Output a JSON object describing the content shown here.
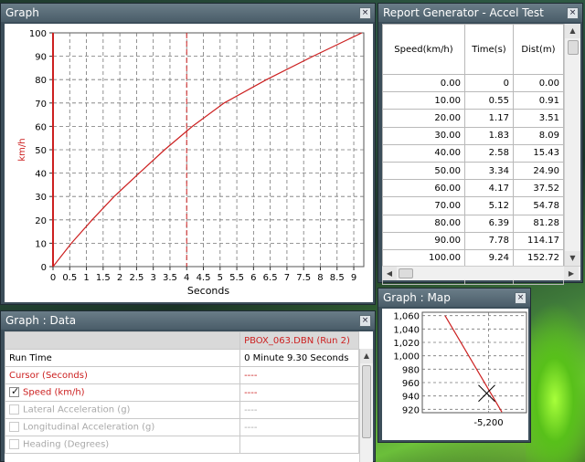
{
  "graph_window": {
    "title": "Graph",
    "close_glyph": "×",
    "chart_data": {
      "type": "line",
      "xlabel": "Seconds",
      "ylabel": "km/h",
      "xlim": [
        0,
        9.3
      ],
      "ylim": [
        0,
        100
      ],
      "x_ticks": [
        "0",
        "0.5",
        "1",
        "1.5",
        "2",
        "2.5",
        "3",
        "3.5",
        "4",
        "4.5",
        "5",
        "5.5",
        "6",
        "6.5",
        "7",
        "7.5",
        "8",
        "8.5",
        "9"
      ],
      "y_ticks": [
        "0",
        "10",
        "20",
        "30",
        "40",
        "50",
        "60",
        "70",
        "80",
        "90",
        "100"
      ],
      "grid": true,
      "cursor_x": 4.0,
      "series": [
        {
          "x": [
            0,
            0.55,
            1.17,
            1.83,
            2.58,
            3.34,
            4.17,
            5.12,
            6.39,
            7.78,
            9.24
          ],
          "y": [
            0,
            10,
            20,
            30,
            40,
            50,
            60,
            70,
            80,
            90,
            100
          ]
        }
      ],
      "colors": {
        "line": "#cc2020",
        "axis": "#cc2020",
        "grid": "#777777",
        "cursor": "#cc2020"
      }
    }
  },
  "report_window": {
    "title": "Report Generator - Accel Test",
    "close_glyph": "×",
    "columns": [
      "Speed(km/h)",
      "Time(s)",
      "Dist(m)"
    ],
    "rows": [
      [
        "0.00",
        "0",
        "0.00"
      ],
      [
        "10.00",
        "0.55",
        "0.91"
      ],
      [
        "20.00",
        "1.17",
        "3.51"
      ],
      [
        "30.00",
        "1.83",
        "8.09"
      ],
      [
        "40.00",
        "2.58",
        "15.43"
      ],
      [
        "50.00",
        "3.34",
        "24.90"
      ],
      [
        "60.00",
        "4.17",
        "37.52"
      ],
      [
        "70.00",
        "5.12",
        "54.78"
      ],
      [
        "80.00",
        "6.39",
        "81.28"
      ],
      [
        "90.00",
        "7.78",
        "114.17"
      ],
      [
        "100.00",
        "9.24",
        "152.72"
      ],
      [
        "",
        "",
        ""
      ]
    ],
    "scroll_up": "▲",
    "scroll_down": "▼",
    "scroll_left": "◀",
    "scroll_right": "▶"
  },
  "data_window": {
    "title": "Graph : Data",
    "close_glyph": "×",
    "file_label": "PBOX_063.DBN (Run 2)",
    "rows": [
      {
        "label": "Run Time",
        "value": "0 Minute 9.30 Seconds",
        "style": "normal",
        "checkbox": "none"
      },
      {
        "label": "Cursor (Seconds)",
        "value": "----",
        "style": "red",
        "checkbox": "none"
      },
      {
        "label": "Speed (km/h)",
        "value": "----",
        "style": "red",
        "checkbox": "on"
      },
      {
        "label": "Lateral Acceleration (g)",
        "value": "----",
        "style": "gray",
        "checkbox": "off"
      },
      {
        "label": "Longitudinal Acceleration (g)",
        "value": "----",
        "style": "gray",
        "checkbox": "off"
      },
      {
        "label": "Heading (Degrees)",
        "value": "",
        "style": "gray",
        "checkbox": "off"
      }
    ],
    "scroll_up": "▲",
    "colors": {
      "red": "#cc2020",
      "gray": "#a8a8a8",
      "normal": "#000000"
    }
  },
  "map_window": {
    "title": "Graph : Map",
    "close_glyph": "×",
    "y_ticks": [
      "1,060",
      "1,040",
      "1,020",
      "1,000",
      "980",
      "960",
      "940",
      "920"
    ],
    "y_values": [
      1060,
      1040,
      1020,
      1000,
      980,
      960,
      940,
      920
    ],
    "x_label": "-5,200",
    "track": {
      "x": [
        -5223,
        -5193
      ],
      "y": [
        1060,
        916
      ]
    },
    "colors": {
      "track": "#cc2020",
      "marker": "#000000"
    }
  }
}
